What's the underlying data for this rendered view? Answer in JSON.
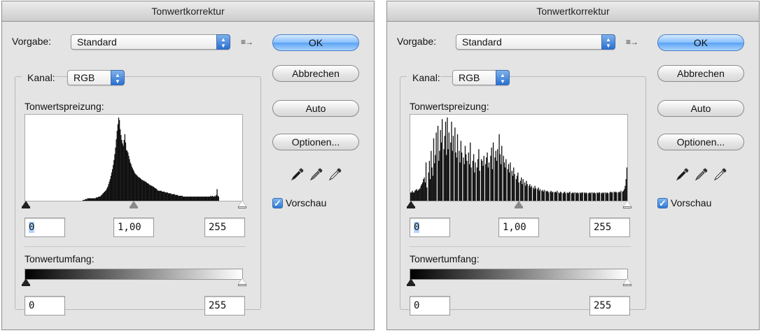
{
  "dialogs": [
    {
      "title": "Tonwertkorrektur",
      "preset_label": "Vorgabe:",
      "preset_value": "Standard",
      "channel_label": "Kanal:",
      "channel_value": "RGB",
      "input_levels_label": "Tonwertspreizung:",
      "input_black": "0",
      "input_gamma": "1,00",
      "input_white": "255",
      "output_levels_label": "Tonwertumfang:",
      "output_black": "0",
      "output_white": "255",
      "ok_label": "OK",
      "cancel_label": "Abbrechen",
      "auto_label": "Auto",
      "options_label": "Optionen...",
      "preview_label": "Vorschau",
      "preview_checked": true,
      "histogram": [
        0,
        0,
        0,
        0,
        0,
        0,
        0,
        0,
        0,
        0,
        0,
        0,
        0,
        0,
        0,
        0,
        0,
        0,
        0,
        0,
        0,
        0,
        0,
        0,
        0,
        0,
        0,
        0,
        0,
        0,
        0,
        0,
        0,
        0,
        0,
        0,
        0,
        0,
        0,
        0,
        0,
        0,
        0,
        0,
        0,
        0,
        0,
        0,
        0,
        0,
        0,
        0,
        0,
        0,
        0,
        0,
        0,
        0,
        0,
        0,
        0,
        0,
        0,
        0,
        0,
        0,
        0,
        0,
        0,
        0,
        0,
        0,
        0,
        0,
        1,
        1,
        1,
        2,
        2,
        2,
        3,
        3,
        3,
        3,
        3,
        3,
        3,
        3,
        3,
        3,
        3,
        4,
        4,
        4,
        5,
        5,
        5,
        6,
        7,
        8,
        9,
        10,
        11,
        12,
        13,
        15,
        17,
        20,
        23,
        26,
        30,
        34,
        38,
        43,
        49,
        56,
        64,
        74,
        84,
        92,
        100,
        97,
        86,
        79,
        73,
        69,
        66,
        73,
        80,
        70,
        61,
        60,
        58,
        54,
        50,
        46,
        44,
        41,
        39,
        37,
        35,
        33,
        32,
        31,
        30,
        29,
        28,
        28,
        27,
        26,
        25,
        25,
        24,
        24,
        23,
        23,
        22,
        21,
        21,
        20,
        19,
        19,
        18,
        18,
        17,
        17,
        16,
        15,
        15,
        14,
        13,
        12,
        12,
        12,
        12,
        12,
        11,
        11,
        11,
        11,
        10,
        10,
        10,
        10,
        9,
        9,
        9,
        9,
        8,
        8,
        8,
        8,
        8,
        7,
        7,
        7,
        7,
        6,
        6,
        6,
        6,
        6,
        6,
        5,
        5,
        5,
        5,
        5,
        5,
        5,
        5,
        5,
        5,
        5,
        5,
        5,
        5,
        5,
        5,
        5,
        5,
        5,
        5,
        5,
        5,
        5,
        5,
        5,
        5,
        5,
        5,
        5,
        5,
        5,
        5,
        5,
        5,
        5,
        5,
        6,
        5,
        6,
        5,
        5,
        6,
        5,
        7,
        14,
        6,
        5,
        0,
        0,
        0,
        0,
        0,
        0,
        0,
        0,
        0,
        0,
        0,
        0,
        0,
        0,
        0,
        0,
        0,
        0,
        0,
        0,
        0,
        0,
        0,
        0,
        0,
        0,
        0,
        0,
        0,
        0
      ]
    },
    {
      "title": "Tonwertkorrektur",
      "preset_label": "Vorgabe:",
      "preset_value": "Standard",
      "channel_label": "Kanal:",
      "channel_value": "RGB",
      "input_levels_label": "Tonwertspreizung:",
      "input_black": "0",
      "input_gamma": "1,00",
      "input_white": "255",
      "output_levels_label": "Tonwertumfang:",
      "output_black": "0",
      "output_white": "255",
      "ok_label": "OK",
      "cancel_label": "Abbrechen",
      "auto_label": "Auto",
      "options_label": "Optionen...",
      "preview_label": "Vorschau",
      "preview_checked": true,
      "histogram": [
        10,
        10,
        12,
        10,
        10,
        12,
        13,
        14,
        12,
        13,
        14,
        15,
        18,
        20,
        22,
        26,
        28,
        22,
        46,
        16,
        0,
        34,
        48,
        26,
        60,
        40,
        30,
        75,
        45,
        55,
        82,
        0,
        90,
        48,
        60,
        85,
        70,
        98,
        0,
        62,
        78,
        95,
        55,
        100,
        62,
        82,
        0,
        70,
        95,
        60,
        78,
        0,
        88,
        58,
        52,
        80,
        0,
        60,
        46,
        72,
        58,
        0,
        52,
        44,
        66,
        56,
        48,
        0,
        58,
        44,
        70,
        40,
        0,
        48,
        56,
        34,
        46,
        0,
        40,
        50,
        62,
        36,
        0,
        50,
        48,
        42,
        54,
        0,
        44,
        52,
        58,
        40,
        46,
        0,
        54,
        64,
        38,
        70,
        0,
        52,
        60,
        48,
        62,
        0,
        80,
        56,
        44,
        66,
        0,
        54,
        46,
        40,
        50,
        0,
        38,
        44,
        34,
        46,
        0,
        36,
        30,
        40,
        32,
        0,
        26,
        30,
        34,
        22,
        0,
        24,
        28,
        20,
        26,
        0,
        22,
        18,
        24,
        20,
        0,
        18,
        20,
        16,
        18,
        0,
        16,
        14,
        18,
        15,
        0,
        14,
        16,
        12,
        14,
        0,
        12,
        13,
        11,
        13,
        0,
        12,
        11,
        12,
        10,
        0,
        11,
        12,
        10,
        11,
        0,
        10,
        11,
        10,
        12,
        0,
        10,
        9,
        11,
        10,
        0,
        9,
        10,
        11,
        9,
        0,
        10,
        9,
        10,
        11,
        0,
        9,
        10,
        9,
        10,
        0,
        10,
        9,
        10,
        9,
        0,
        10,
        9,
        10,
        10,
        0,
        10,
        9,
        10,
        9,
        0,
        9,
        10,
        9,
        10,
        0,
        10,
        9,
        10,
        9,
        0,
        10,
        9,
        10,
        10,
        0,
        9,
        10,
        9,
        10,
        0,
        10,
        9,
        10,
        9,
        0,
        10,
        11,
        10,
        10,
        0,
        11,
        10,
        11,
        10,
        0,
        10,
        11,
        10,
        12,
        0,
        11,
        12,
        14,
        18,
        26,
        40
      ]
    }
  ]
}
